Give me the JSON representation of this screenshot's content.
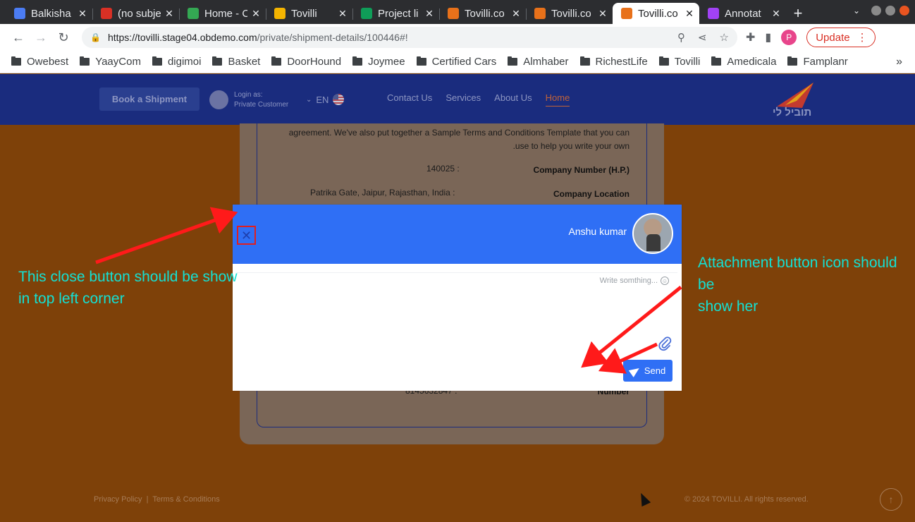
{
  "browser": {
    "tabs": [
      {
        "title": "Balkisha",
        "favicon_color": "#4b7cf3"
      },
      {
        "title": "(no subje",
        "favicon_color": "#d93025"
      },
      {
        "title": "Home - C",
        "favicon_color": "#34a853"
      },
      {
        "title": "Tovilli",
        "favicon_color": "#f4b400"
      },
      {
        "title": "Project li",
        "favicon_color": "#0f9d58"
      },
      {
        "title": "Tovilli.co",
        "favicon_color": "#e8711a"
      },
      {
        "title": "Tovilli.co",
        "favicon_color": "#e8711a"
      },
      {
        "title": "Tovilli.co",
        "favicon_color": "#e8711a",
        "active": true
      },
      {
        "title": "Annotat",
        "favicon_color": "#a142f4"
      }
    ],
    "new_tab": "+",
    "url_host": "https://tovilli.stage04.obdemo.com",
    "url_path": "/private/shipment-details/100446#!",
    "update_label": "Update",
    "profile_initial": "P",
    "bookmarks": [
      "Owebest",
      "YaayCom",
      "digimoi",
      "Basket",
      "DoorHound",
      "Joymee",
      "Certified Cars",
      "Almhaber",
      "RichestLife",
      "Tovilli",
      "Amedicala",
      "Famplanr"
    ],
    "bookmarks_more": "»"
  },
  "site": {
    "book_button": "Book a Shipment",
    "login_label": "Login as:",
    "login_role": "Private Customer",
    "language": "EN",
    "nav": [
      "Contact Us",
      "Services",
      "About Us",
      "Home"
    ],
    "logo_text": "תוביל לי"
  },
  "card": {
    "agreement_line1": "agreement. We've also put together a Sample Terms and Conditions Template that you can",
    "agreement_line2": ".use to help you write your own",
    "company_number_value": "140025 :",
    "company_number_label": "Company Number (H.P.)",
    "company_location_value": "Patrika Gate, Jaipur, Rajasthan, India :",
    "company_location_label": "Company Location",
    "phone_value": "8145632847 :",
    "phone_label": "Number"
  },
  "modal": {
    "close_glyph": "✕",
    "user_name": "Anshu kumar",
    "placeholder": "Write somthing...",
    "send_label": "Send"
  },
  "annotations": {
    "close_note_line1": "This close button should be show",
    "close_note_line2": "in top left corner",
    "attach_note_line1": "Attachment button icon should be",
    "attach_note_line2": "show her"
  },
  "footer": {
    "privacy": "Privacy Policy",
    "terms": "Terms & Conditions",
    "copyright": "© 2024 TOVILLI. All rights reserved."
  }
}
